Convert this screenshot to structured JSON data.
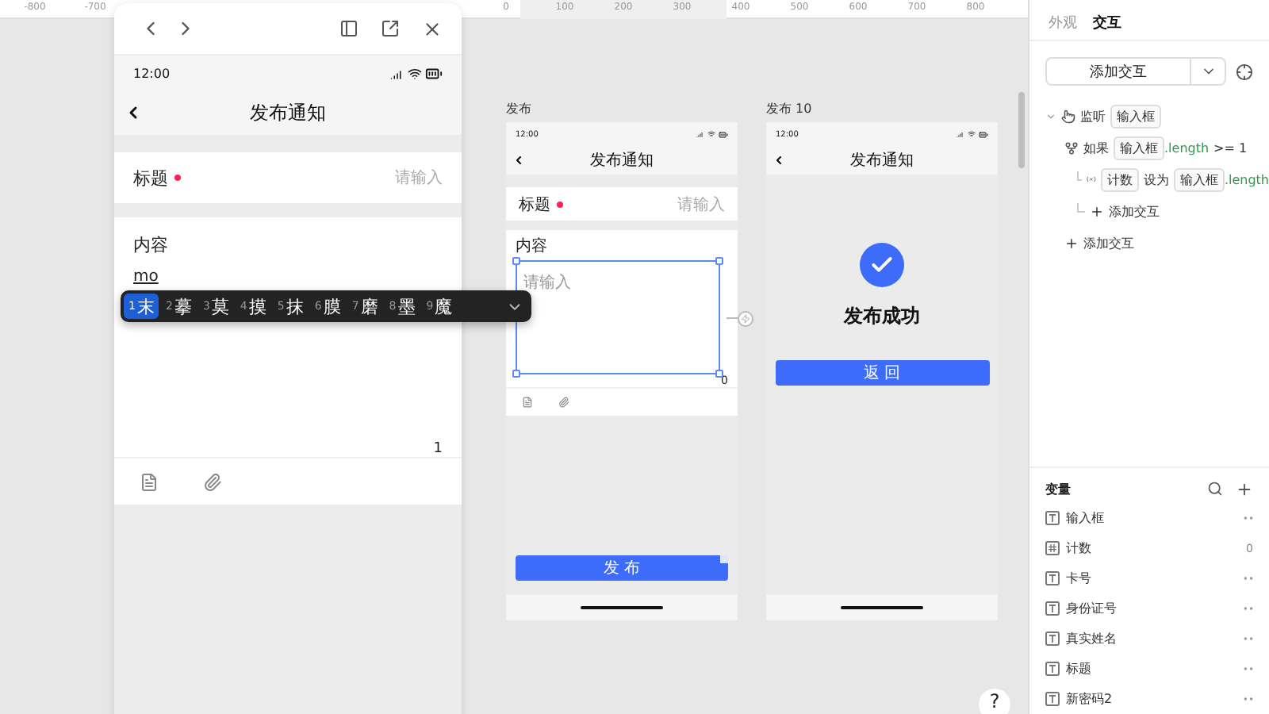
{
  "ruler": {
    "labels": [
      "-800",
      "-700",
      "0",
      "100",
      "200",
      "300",
      "400",
      "500",
      "600",
      "700",
      "800"
    ]
  },
  "preview": {
    "time": "12:00",
    "title": "发布通知",
    "field": {
      "label": "标题",
      "required": true,
      "placeholder": "请输入"
    },
    "content": {
      "label": "内容",
      "typed": "mo",
      "counter": "1"
    },
    "ime": {
      "candidates": [
        {
          "num": "1",
          "char": "末",
          "selected": true
        },
        {
          "num": "2",
          "char": "摹",
          "selected": false
        },
        {
          "num": "3",
          "char": "莫",
          "selected": false
        },
        {
          "num": "4",
          "char": "摸",
          "selected": false
        },
        {
          "num": "5",
          "char": "抹",
          "selected": false
        },
        {
          "num": "6",
          "char": "膜",
          "selected": false
        },
        {
          "num": "7",
          "char": "磨",
          "selected": false
        },
        {
          "num": "8",
          "char": "墨",
          "selected": false
        },
        {
          "num": "9",
          "char": "魔",
          "selected": false
        }
      ]
    }
  },
  "artboards": [
    {
      "kind": "form",
      "name": "发布",
      "time": "12:00",
      "title": "发布通知",
      "field_label": "标题",
      "required": true,
      "placeholder": "请输入",
      "content_label": "内容",
      "textarea_placeholder": "请输入",
      "counter": "0",
      "button": "发 布"
    },
    {
      "kind": "success",
      "name": "发布 10",
      "time": "12:00",
      "title": "发布通知",
      "message": "发布成功",
      "button": "返 回"
    }
  ],
  "panel": {
    "tabs": [
      {
        "label": "外观",
        "selected": false
      },
      {
        "label": "交互",
        "selected": true
      }
    ],
    "add_button": "添加交互",
    "interactions": [
      {
        "kind": "listen",
        "label": "监听",
        "parts": [
          {
            "kind": "tag",
            "text": "输入框"
          }
        ],
        "children": [
          {
            "kind": "condition",
            "label": "如果",
            "parts": [
              {
                "kind": "tag",
                "text": "输入框"
              },
              {
                "kind": "prop",
                "text": ".length"
              },
              {
                "kind": "plain",
                "text": ">= 1"
              }
            ],
            "children": [
              {
                "kind": "set",
                "parts": [
                  {
                    "kind": "tag",
                    "text": "计数"
                  },
                  {
                    "kind": "plain",
                    "text": "设为"
                  },
                  {
                    "kind": "tag",
                    "text": "输入框"
                  },
                  {
                    "kind": "prop",
                    "text": ".length"
                  }
                ]
              },
              {
                "kind": "add",
                "label": "添加交互"
              }
            ]
          },
          {
            "kind": "add",
            "label": "添加交互"
          }
        ]
      }
    ],
    "variables_title": "变量",
    "variables": [
      {
        "kind": "text",
        "name": "输入框"
      },
      {
        "kind": "number",
        "name": "计数",
        "value": "0"
      },
      {
        "kind": "text",
        "name": "卡号"
      },
      {
        "kind": "text",
        "name": "身份证号"
      },
      {
        "kind": "text",
        "name": "真实姓名"
      },
      {
        "kind": "text",
        "name": "标题"
      },
      {
        "kind": "text",
        "name": "新密码2"
      }
    ]
  },
  "help": "?"
}
